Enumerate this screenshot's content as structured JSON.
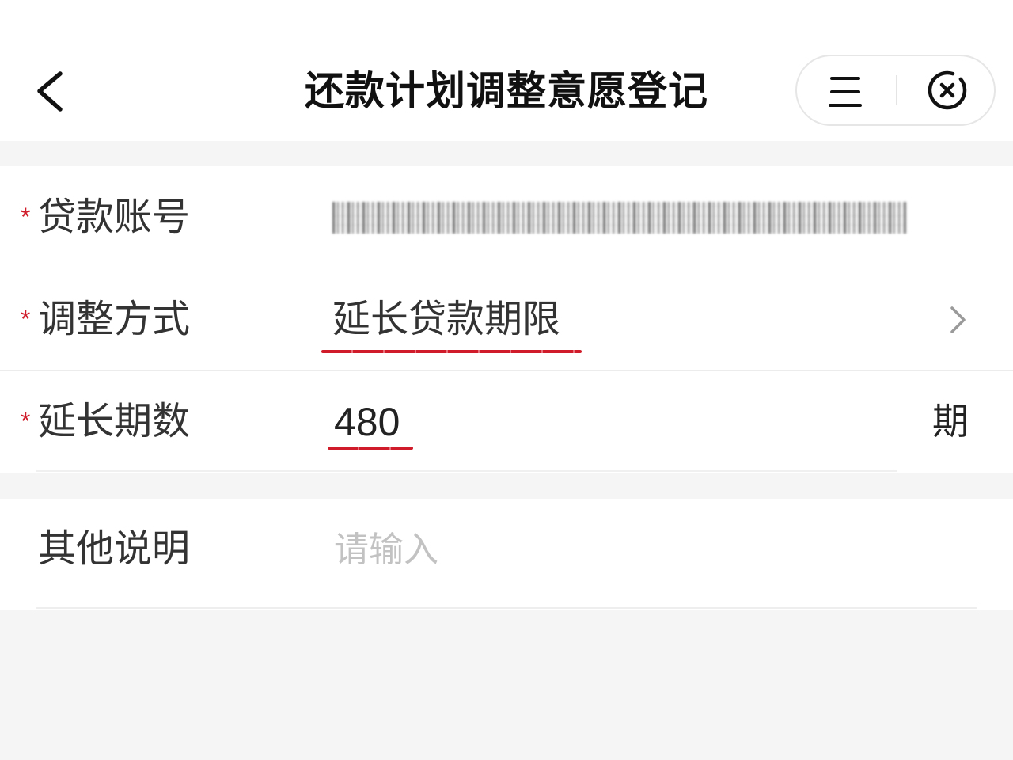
{
  "header": {
    "title": "还款计划调整意愿登记",
    "icons": {
      "back": "chevron-left-icon",
      "menu": "menu-icon",
      "close": "close-circle-icon"
    }
  },
  "form": {
    "required_mark": "*",
    "loan_account": {
      "label": "贷款账号",
      "value_masked": true
    },
    "adjust_method": {
      "label": "调整方式",
      "value": "延长贷款期限",
      "icon": "chevron-right-icon"
    },
    "extension_periods": {
      "label": "延长期数",
      "value": "480",
      "unit": "期"
    },
    "other_notes": {
      "label": "其他说明",
      "placeholder": "请输入"
    }
  },
  "colors": {
    "accent_red": "#d01c2a",
    "text": "#333333",
    "placeholder": "#c2c2c2",
    "page_background": "#f5f5f5",
    "card_background": "#ffffff"
  }
}
